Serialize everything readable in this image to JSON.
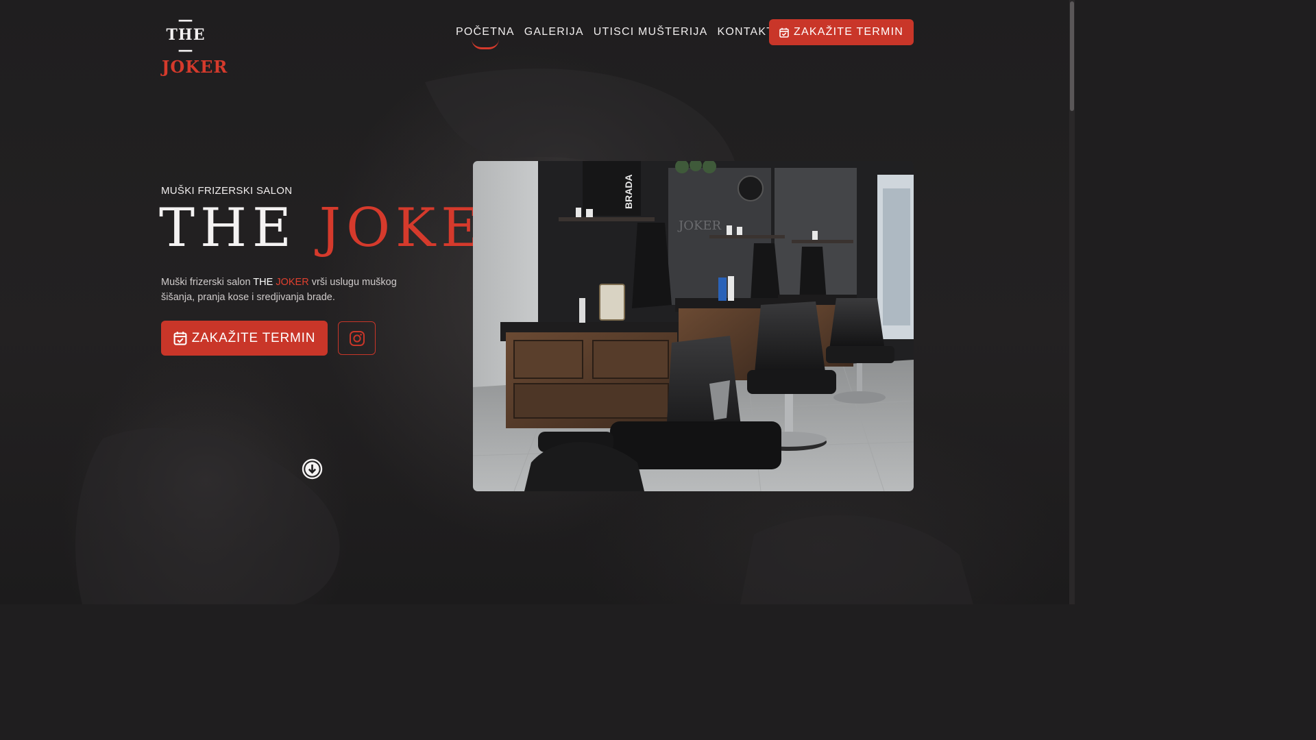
{
  "header": {
    "logo": {
      "line1": "—THE—",
      "line2": "JOKER"
    },
    "nav": [
      {
        "label": "POČETNA",
        "active": true
      },
      {
        "label": "GALERIJA",
        "active": false
      },
      {
        "label": "UTISCI MUŠTERIJA",
        "active": false
      },
      {
        "label": "KONTAKT",
        "active": false
      }
    ],
    "cta_label": "ZAKAŽITE TERMIN",
    "cta_icon": "calendar-check-icon"
  },
  "hero": {
    "eyebrow": "MUŠKI FRIZERSKI SALON",
    "title_part1": "THE",
    "title_part2": "JOKER",
    "description": {
      "before": "Muški frizerski salon ",
      "brand_white": "THE",
      "brand_red": "JOKER",
      "after": " vrši uslugu muškog šišanja, pranja kose i sredjivanja brade."
    },
    "cta_label": "ZAKAŽITE TERMIN",
    "cta_icon": "calendar-check-icon",
    "social_icon": "instagram-icon",
    "scroll_icon": "arrow-down-circle-icon",
    "photo_text": {
      "sign1": "BRADA",
      "mirror": "JOKER"
    }
  },
  "colors": {
    "accent": "#c93629",
    "accent_text": "#d53a2c",
    "background": "#1f1e1f",
    "text": "#f1eeee"
  }
}
